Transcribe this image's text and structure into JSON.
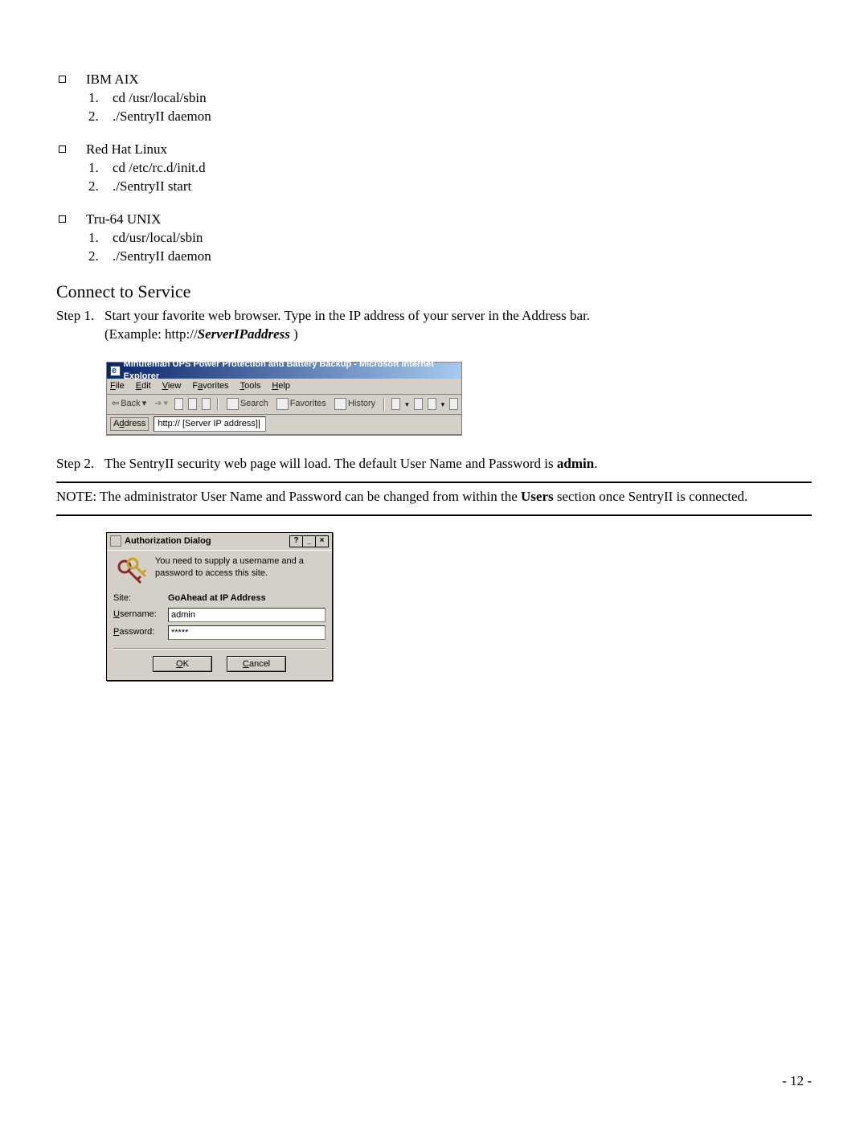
{
  "os_list": [
    {
      "name": "IBM AIX",
      "cmds": [
        "cd /usr/local/sbin",
        "./SentryII daemon"
      ]
    },
    {
      "name": "Red Hat Linux",
      "cmds": [
        "cd /etc/rc.d/init.d",
        "./SentryII start"
      ]
    },
    {
      "name": "Tru-64 UNIX",
      "cmds": [
        "cd/usr/local/sbin",
        "./SentryII daemon"
      ]
    }
  ],
  "connect_heading": "Connect to Service",
  "step1": {
    "label": "Step 1.",
    "text": "Start your favorite web browser. Type in the IP address of your server in the Address bar.",
    "example_prefix": "(Example: http://",
    "example_bold": "ServerIPaddress",
    "example_suffix": " )"
  },
  "ie": {
    "title": "Minuteman UPS Power Protection and Battery Backup - Microsoft Internet Explorer",
    "menu": [
      "File",
      "Edit",
      "View",
      "Favorites",
      "Tools",
      "Help"
    ],
    "tool_back": "Back",
    "tool_search": "Search",
    "tool_fav": "Favorites",
    "tool_hist": "History",
    "addr_label": "Address",
    "addr_value": "http:// [Server IP address]"
  },
  "step2": {
    "label": "Step 2.",
    "text_a": "The SentryII security web page will load.  The default User Name and Password is ",
    "text_bold": "admin",
    "text_b": "."
  },
  "note": {
    "prefix": "NOTE: The administrator User Name and Password can be changed from within the ",
    "bold": "Users",
    "suffix": " section once SentryII is connected."
  },
  "dlg": {
    "title": "Authorization Dialog",
    "msg": "You need to supply a username and a password to access this site.",
    "site_label": "Site:",
    "site_value": "GoAhead at IP Address",
    "user_label": "Username:",
    "user_value": "admin",
    "pass_label": "Password:",
    "pass_value": "*****",
    "ok": "OK",
    "cancel": "Cancel"
  },
  "page_number": "- 12 -"
}
